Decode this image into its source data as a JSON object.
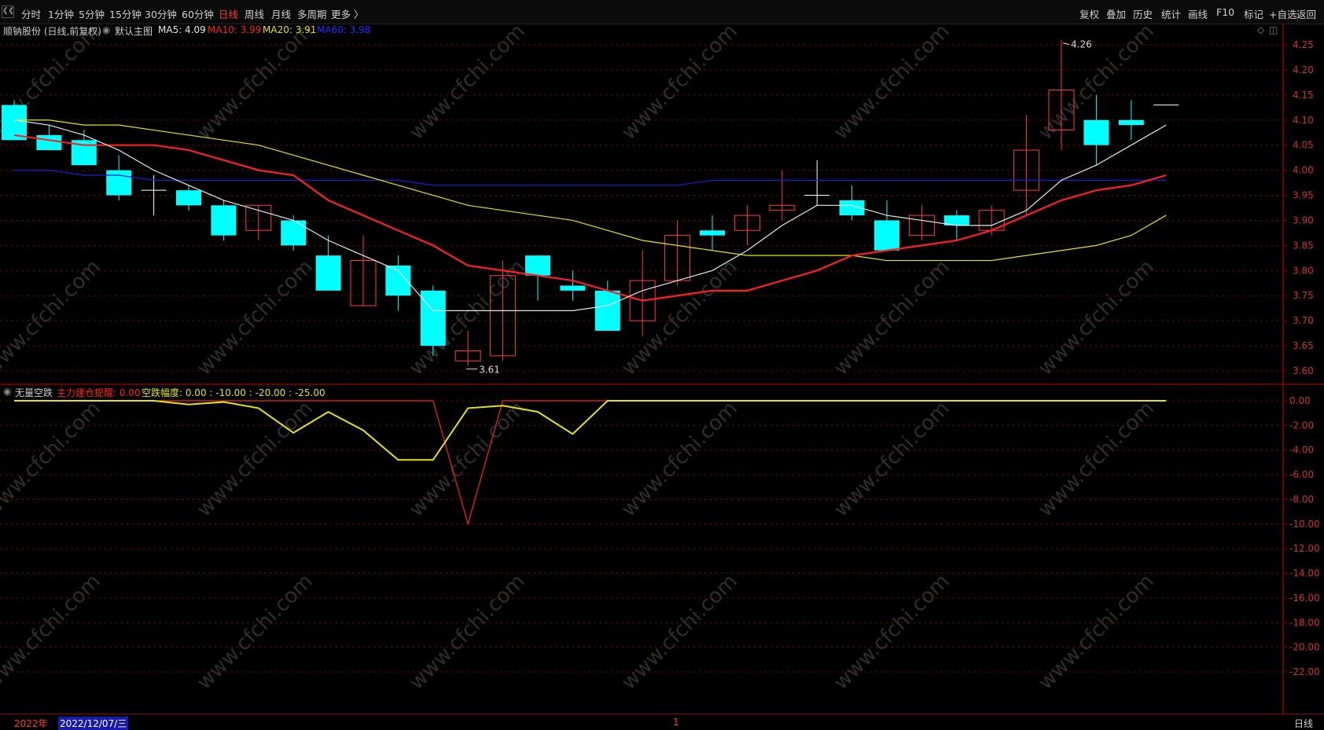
{
  "toolbar": {
    "periods": [
      {
        "label": "分时"
      },
      {
        "label": "1分钟"
      },
      {
        "label": "5分钟"
      },
      {
        "label": "15分钟"
      },
      {
        "label": "30分钟"
      },
      {
        "label": "60分钟"
      },
      {
        "label": "日线"
      },
      {
        "label": "周线"
      },
      {
        "label": "月线"
      },
      {
        "label": "多周期"
      },
      {
        "label": "更多 〉"
      }
    ],
    "active_index": 6,
    "right_buttons": [
      {
        "label": "复权"
      },
      {
        "label": "叠加"
      },
      {
        "label": "历史"
      },
      {
        "label": "统计"
      },
      {
        "label": "画线"
      },
      {
        "label": "F10"
      },
      {
        "label": "标记"
      },
      {
        "label": "+自选"
      },
      {
        "label": "返回"
      }
    ]
  },
  "main_header": {
    "stock": "顺钠股份 (日线,前复权)",
    "template": "默认主图",
    "ma5": "MA5: 4.09",
    "ma10": "MA10: 3.99",
    "ma20": "MA20: 3.91",
    "ma60": "MA60: 3.98"
  },
  "sub_header": {
    "name": "无量空跌",
    "line1": "主力建仓提醒: 0.00",
    "line2": "空跌幅度: 0.00 : -10.00 : -20.00 : -25.00"
  },
  "annotations": {
    "high_label": "4.26",
    "low_label": "3.61"
  },
  "watermark": "www.cfchi.com",
  "bottom_bar": {
    "year": "2022年",
    "date": "2022/12/07/三",
    "mid_mark": "1",
    "period": "日线"
  },
  "colors": {
    "up": "#ff3b3b",
    "down": "#00ffff",
    "ma5": "#e8e8e8",
    "ma10": "#ff2020",
    "ma20": "#e6e600",
    "ma60": "#1e1ed0",
    "grid": "#8b0000",
    "axis_text": "#d03030"
  },
  "chart_data": [
    {
      "type": "candlestick",
      "ylim": [
        3.57,
        4.32
      ],
      "y_ticks": [
        "4.25",
        "4.20",
        "4.15",
        "4.10",
        "4.05",
        "4.00",
        "3.95",
        "3.90",
        "3.85",
        "3.80",
        "3.75",
        "3.70",
        "3.65",
        "3.60"
      ],
      "candles": [
        {
          "o": 4.13,
          "h": 4.14,
          "l": 4.07,
          "c": 4.06
        },
        {
          "o": 4.07,
          "h": 4.09,
          "l": 4.04,
          "c": 4.04
        },
        {
          "o": 4.06,
          "h": 4.08,
          "l": 4.01,
          "c": 4.01
        },
        {
          "o": 4.0,
          "h": 4.03,
          "l": 3.94,
          "c": 3.95
        },
        {
          "o": 3.96,
          "h": 3.99,
          "l": 3.91,
          "c": 3.96
        },
        {
          "o": 3.96,
          "h": 3.97,
          "l": 3.92,
          "c": 3.93
        },
        {
          "o": 3.93,
          "h": 3.94,
          "l": 3.86,
          "c": 3.87
        },
        {
          "o": 3.88,
          "h": 3.93,
          "l": 3.86,
          "c": 3.93
        },
        {
          "o": 3.9,
          "h": 3.91,
          "l": 3.84,
          "c": 3.85
        },
        {
          "o": 3.83,
          "h": 3.87,
          "l": 3.76,
          "c": 3.76
        },
        {
          "o": 3.73,
          "h": 3.87,
          "l": 3.73,
          "c": 3.82
        },
        {
          "o": 3.81,
          "h": 3.83,
          "l": 3.72,
          "c": 3.75
        },
        {
          "o": 3.76,
          "h": 3.77,
          "l": 3.63,
          "c": 3.65
        },
        {
          "o": 3.62,
          "h": 3.68,
          "l": 3.61,
          "c": 3.64
        },
        {
          "o": 3.63,
          "h": 3.82,
          "l": 3.62,
          "c": 3.79
        },
        {
          "o": 3.83,
          "h": 3.83,
          "l": 3.74,
          "c": 3.79
        },
        {
          "o": 3.77,
          "h": 3.8,
          "l": 3.74,
          "c": 3.76
        },
        {
          "o": 3.76,
          "h": 3.78,
          "l": 3.68,
          "c": 3.68
        },
        {
          "o": 3.7,
          "h": 3.84,
          "l": 3.67,
          "c": 3.78
        },
        {
          "o": 3.78,
          "h": 3.9,
          "l": 3.77,
          "c": 3.87
        },
        {
          "o": 3.88,
          "h": 3.91,
          "l": 3.84,
          "c": 3.87
        },
        {
          "o": 3.88,
          "h": 3.93,
          "l": 3.85,
          "c": 3.91
        },
        {
          "o": 3.92,
          "h": 4.0,
          "l": 3.9,
          "c": 3.93
        },
        {
          "o": 3.95,
          "h": 4.02,
          "l": 3.93,
          "c": 3.95
        },
        {
          "o": 3.94,
          "h": 3.97,
          "l": 3.9,
          "c": 3.91
        },
        {
          "o": 3.9,
          "h": 3.94,
          "l": 3.84,
          "c": 3.84
        },
        {
          "o": 3.87,
          "h": 3.93,
          "l": 3.86,
          "c": 3.91
        },
        {
          "o": 3.91,
          "h": 3.92,
          "l": 3.86,
          "c": 3.89
        },
        {
          "o": 3.88,
          "h": 3.93,
          "l": 3.87,
          "c": 3.92
        },
        {
          "o": 3.96,
          "h": 4.11,
          "l": 3.91,
          "c": 4.04
        },
        {
          "o": 4.08,
          "h": 4.26,
          "l": 4.04,
          "c": 4.16
        },
        {
          "o": 4.1,
          "h": 4.15,
          "l": 4.01,
          "c": 4.05
        },
        {
          "o": 4.1,
          "h": 4.14,
          "l": 4.06,
          "c": 4.09
        },
        {
          "o": 4.13,
          "h": 4.13,
          "l": 4.13,
          "c": 4.13
        }
      ],
      "ma5": [
        4.1,
        4.09,
        4.07,
        4.04,
        4.0,
        3.97,
        3.94,
        3.92,
        3.9,
        3.86,
        3.83,
        3.8,
        3.72,
        3.72,
        3.72,
        3.72,
        3.72,
        3.73,
        3.76,
        3.78,
        3.8,
        3.84,
        3.89,
        3.93,
        3.93,
        3.91,
        3.9,
        3.89,
        3.89,
        3.92,
        3.98,
        4.01,
        4.05,
        4.09
      ],
      "ma10": [
        4.07,
        4.06,
        4.05,
        4.05,
        4.05,
        4.04,
        4.02,
        4.0,
        3.99,
        3.94,
        3.91,
        3.88,
        3.85,
        3.81,
        3.8,
        3.79,
        3.78,
        3.76,
        3.74,
        3.75,
        3.76,
        3.76,
        3.78,
        3.8,
        3.83,
        3.84,
        3.85,
        3.86,
        3.88,
        3.91,
        3.94,
        3.96,
        3.97,
        3.99
      ],
      "ma20": [
        4.1,
        4.1,
        4.09,
        4.09,
        4.08,
        4.07,
        4.06,
        4.05,
        4.03,
        4.01,
        3.99,
        3.97,
        3.95,
        3.93,
        3.92,
        3.91,
        3.9,
        3.88,
        3.86,
        3.85,
        3.84,
        3.83,
        3.83,
        3.83,
        3.83,
        3.82,
        3.82,
        3.82,
        3.82,
        3.83,
        3.84,
        3.85,
        3.87,
        3.91
      ],
      "ma60": [
        4.0,
        4.0,
        3.99,
        3.99,
        3.98,
        3.98,
        3.98,
        3.98,
        3.98,
        3.98,
        3.98,
        3.98,
        3.97,
        3.97,
        3.97,
        3.97,
        3.97,
        3.97,
        3.97,
        3.97,
        3.98,
        3.98,
        3.98,
        3.98,
        3.98,
        3.98,
        3.98,
        3.98,
        3.98,
        3.98,
        3.98,
        3.98,
        3.98,
        3.98
      ]
    },
    {
      "type": "line",
      "ylim": [
        -25,
        1.5
      ],
      "y_ticks": [
        "0.00",
        "-2.00",
        "-4.00",
        "-6.00",
        "-8.00",
        "-10.00",
        "-12.00",
        "-14.00",
        "-16.00",
        "-18.00",
        "-20.00",
        "-22.00"
      ],
      "series": [
        {
          "name": "主力建仓提醒",
          "values": [
            0,
            0,
            0,
            0,
            0,
            0,
            0,
            0,
            0,
            0,
            0,
            0,
            0,
            -10,
            0,
            0,
            0,
            0,
            0,
            0,
            0,
            0,
            0,
            0,
            0,
            0,
            0,
            0,
            0,
            0,
            0,
            0,
            0,
            0
          ]
        },
        {
          "name": "空跌幅度",
          "values": [
            0,
            0,
            0,
            0,
            0,
            -0.3,
            -0.1,
            -0.6,
            -2.6,
            -0.9,
            -2.4,
            -4.8,
            -4.8,
            -0.6,
            -0.4,
            -0.9,
            -2.7,
            0,
            0,
            0,
            0,
            0,
            0,
            0,
            0,
            0,
            0,
            0,
            0,
            0,
            0,
            0,
            0,
            0
          ]
        }
      ]
    }
  ]
}
